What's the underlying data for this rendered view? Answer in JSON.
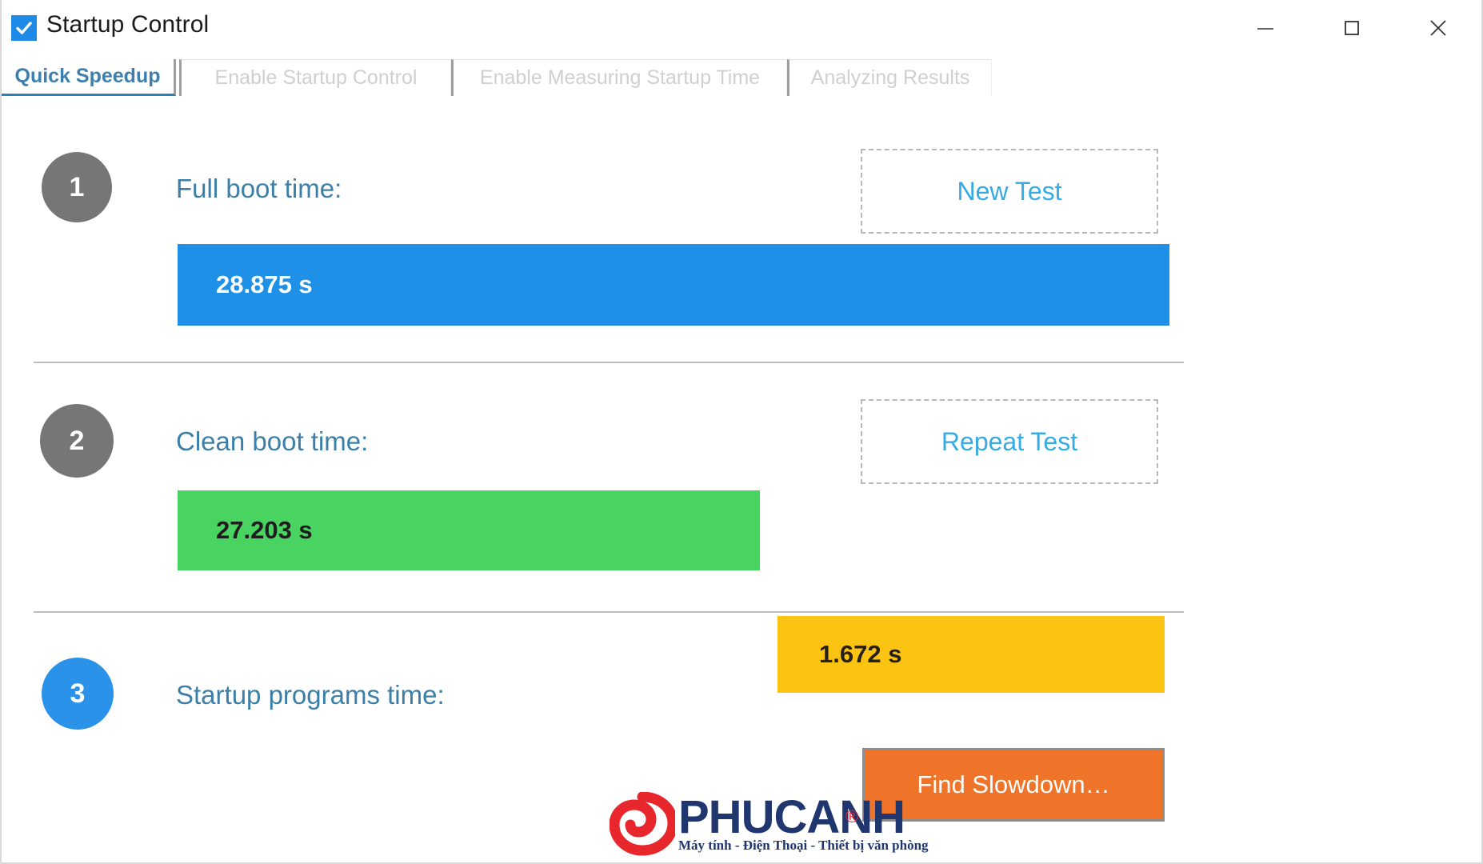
{
  "window": {
    "title": "Startup Control",
    "icon": "checkbox-checked-icon",
    "controls": [
      {
        "name": "minimize",
        "glyph": "—"
      },
      {
        "name": "maximize",
        "glyph": "□"
      },
      {
        "name": "close",
        "glyph": "✕"
      }
    ]
  },
  "tabs": [
    {
      "label": "Quick Speedup",
      "active": true
    },
    {
      "label": "Enable Startup Control",
      "active": false
    },
    {
      "label": "Enable Measuring Startup Time",
      "active": false
    },
    {
      "label": "Analyzing Results",
      "active": false
    }
  ],
  "sections": [
    {
      "number": "1",
      "badge_color": "#767676",
      "label": "Full boot time:",
      "value": "28.875 s",
      "bar_color": "#1e90e8",
      "button": "New Test"
    },
    {
      "number": "2",
      "badge_color": "#767676",
      "label": "Clean boot time:",
      "value": "27.203 s",
      "bar_color": "#49d361",
      "button": "Repeat Test"
    },
    {
      "number": "3",
      "badge_color": "#2a92e8",
      "label": "Startup programs time:",
      "value": "1.672 s",
      "bar_color": "#fbc312",
      "button": "Find Slowdown…"
    }
  ],
  "watermark": {
    "brand": "PHUCANH",
    "registered": "®",
    "tagline": "Máy tính - Điện Thoại - Thiết bị văn phòng"
  },
  "colors": {
    "accent_blue": "#1e90e8",
    "link_blue": "#36aae2",
    "label_blue": "#3b7fa8",
    "green": "#49d361",
    "yellow": "#fbc312",
    "orange": "#ef7429",
    "badge_grey": "#767676",
    "tab_inactive": "#cfcfcf"
  }
}
